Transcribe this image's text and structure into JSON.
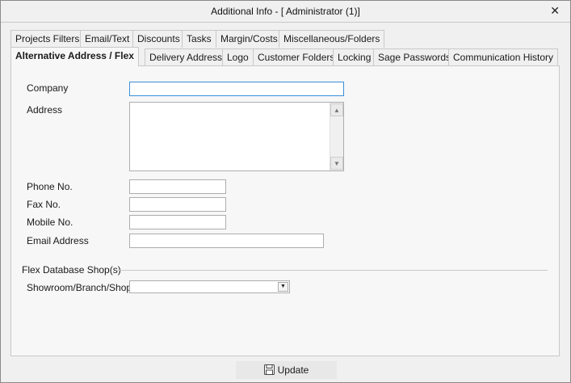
{
  "window": {
    "title": "Additional Info - [ Administrator (1)]",
    "close_glyph": "✕"
  },
  "tabs_row1": [
    {
      "label": "Projects Filters"
    },
    {
      "label": "Email/Text"
    },
    {
      "label": "Discounts"
    },
    {
      "label": "Tasks"
    },
    {
      "label": "Margin/Costs"
    },
    {
      "label": "Miscellaneous/Folders"
    }
  ],
  "tabs_row2": [
    {
      "label": "Alternative Address / Flex",
      "active": true
    },
    {
      "label": "Delivery Address"
    },
    {
      "label": "Logo"
    },
    {
      "label": "Customer Folders"
    },
    {
      "label": "Locking"
    },
    {
      "label": "Sage Passwords"
    },
    {
      "label": "Communication History"
    }
  ],
  "form": {
    "company_label": "Company",
    "company_value": "",
    "address_label": "Address",
    "address_value": "",
    "phone_label": "Phone No.",
    "phone_value": "",
    "fax_label": "Fax No.",
    "fax_value": "",
    "mobile_label": "Mobile No.",
    "mobile_value": "",
    "email_label": "Email Address",
    "email_value": ""
  },
  "flex_section": {
    "title": "Flex Database Shop(s)",
    "showroom_label": "Showroom/Branch/Shop",
    "showroom_value": ""
  },
  "footer": {
    "update_label": "Update",
    "update_icon": "save-icon"
  }
}
